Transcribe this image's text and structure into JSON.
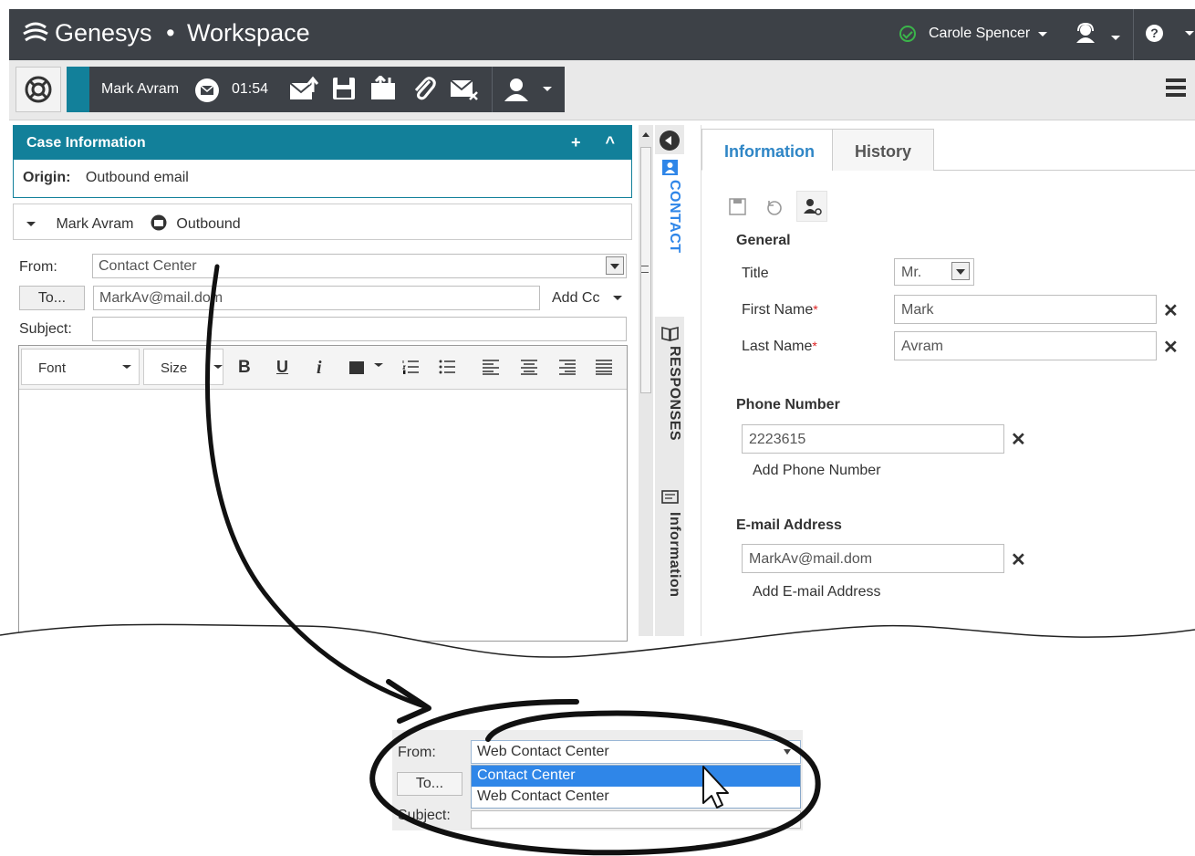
{
  "app": {
    "brand": "Genesys",
    "separator": "•",
    "product": "Workspace"
  },
  "user": {
    "name": "Carole Spencer"
  },
  "interaction": {
    "contact_name": "Mark Avram",
    "timer": "01:54"
  },
  "case": {
    "title": "Case Information",
    "origin_label": "Origin:",
    "origin_value": "Outbound email",
    "add": "+",
    "collapse": "^"
  },
  "email": {
    "contact_name": "Mark Avram",
    "direction": "Outbound",
    "from_label": "From:",
    "from_value": "Contact Center",
    "to_button": "To...",
    "to_value": "MarkAv@mail.dom",
    "add_cc": "Add Cc",
    "subject_label": "Subject:",
    "subject_value": ""
  },
  "editor": {
    "font": "Font",
    "size": "Size",
    "bold": "B",
    "underline": "U",
    "italic": "i"
  },
  "side_tabs": {
    "contact": "CONTACT",
    "responses": "RESPONSES",
    "information": "Information"
  },
  "contact_panel": {
    "tabs": [
      "Information",
      "History"
    ],
    "general": "General",
    "title_label": "Title",
    "title_value": "Mr.",
    "first_name_label": "First Name",
    "first_name_value": "Mark",
    "last_name_label": "Last Name",
    "last_name_value": "Avram",
    "phone_header": "Phone Number",
    "phone_value": "2223615",
    "add_phone": "Add Phone Number",
    "email_header": "E-mail Address",
    "email_value": "MarkAv@mail.dom",
    "add_email": "Add E-mail Address",
    "required_mark": "*",
    "remove": "✕"
  },
  "zoom_detail": {
    "from_label": "From:",
    "selected": "Web Contact Center",
    "options": [
      "Contact Center",
      "Web Contact Center"
    ],
    "to_button": "To...",
    "subject_label": "Subject:"
  }
}
